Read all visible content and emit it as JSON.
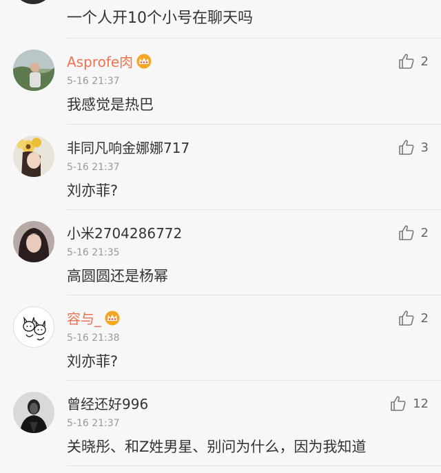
{
  "top_fragment": {
    "text": "一个人开10个小号在聊天吗"
  },
  "comments": [
    {
      "name": "Asprofe肉",
      "vip": true,
      "time": "5-16 21:37",
      "content": "我感觉是热巴",
      "likes": "2",
      "avatar": "avatar-photo-icon"
    },
    {
      "name": "非同凡响金娜娜717",
      "vip": false,
      "time": "5-16 21:37",
      "content": "刘亦菲?",
      "likes": "3",
      "avatar": "avatar-photo-icon"
    },
    {
      "name": "小米2704286772",
      "vip": false,
      "time": "5-16 21:35",
      "content": "高圆圆还是杨幂",
      "likes": "2",
      "avatar": "avatar-photo-icon"
    },
    {
      "name": "容与_",
      "vip": true,
      "time": "5-16 21:38",
      "content": "刘亦菲?",
      "likes": "2",
      "avatar": "avatar-cartoon-icon"
    },
    {
      "name": "曾经还好996",
      "vip": false,
      "time": "5-16 21:37",
      "content": "关晓彤、和Z姓男星、别问为什么，因为我知道",
      "likes": "12",
      "avatar": "avatar-photo-icon"
    }
  ],
  "colors": {
    "background": "#f7f7f7",
    "vip_name": "#eb7350",
    "crown": "#f5a623",
    "timestamp": "#999999",
    "text": "#333333"
  }
}
